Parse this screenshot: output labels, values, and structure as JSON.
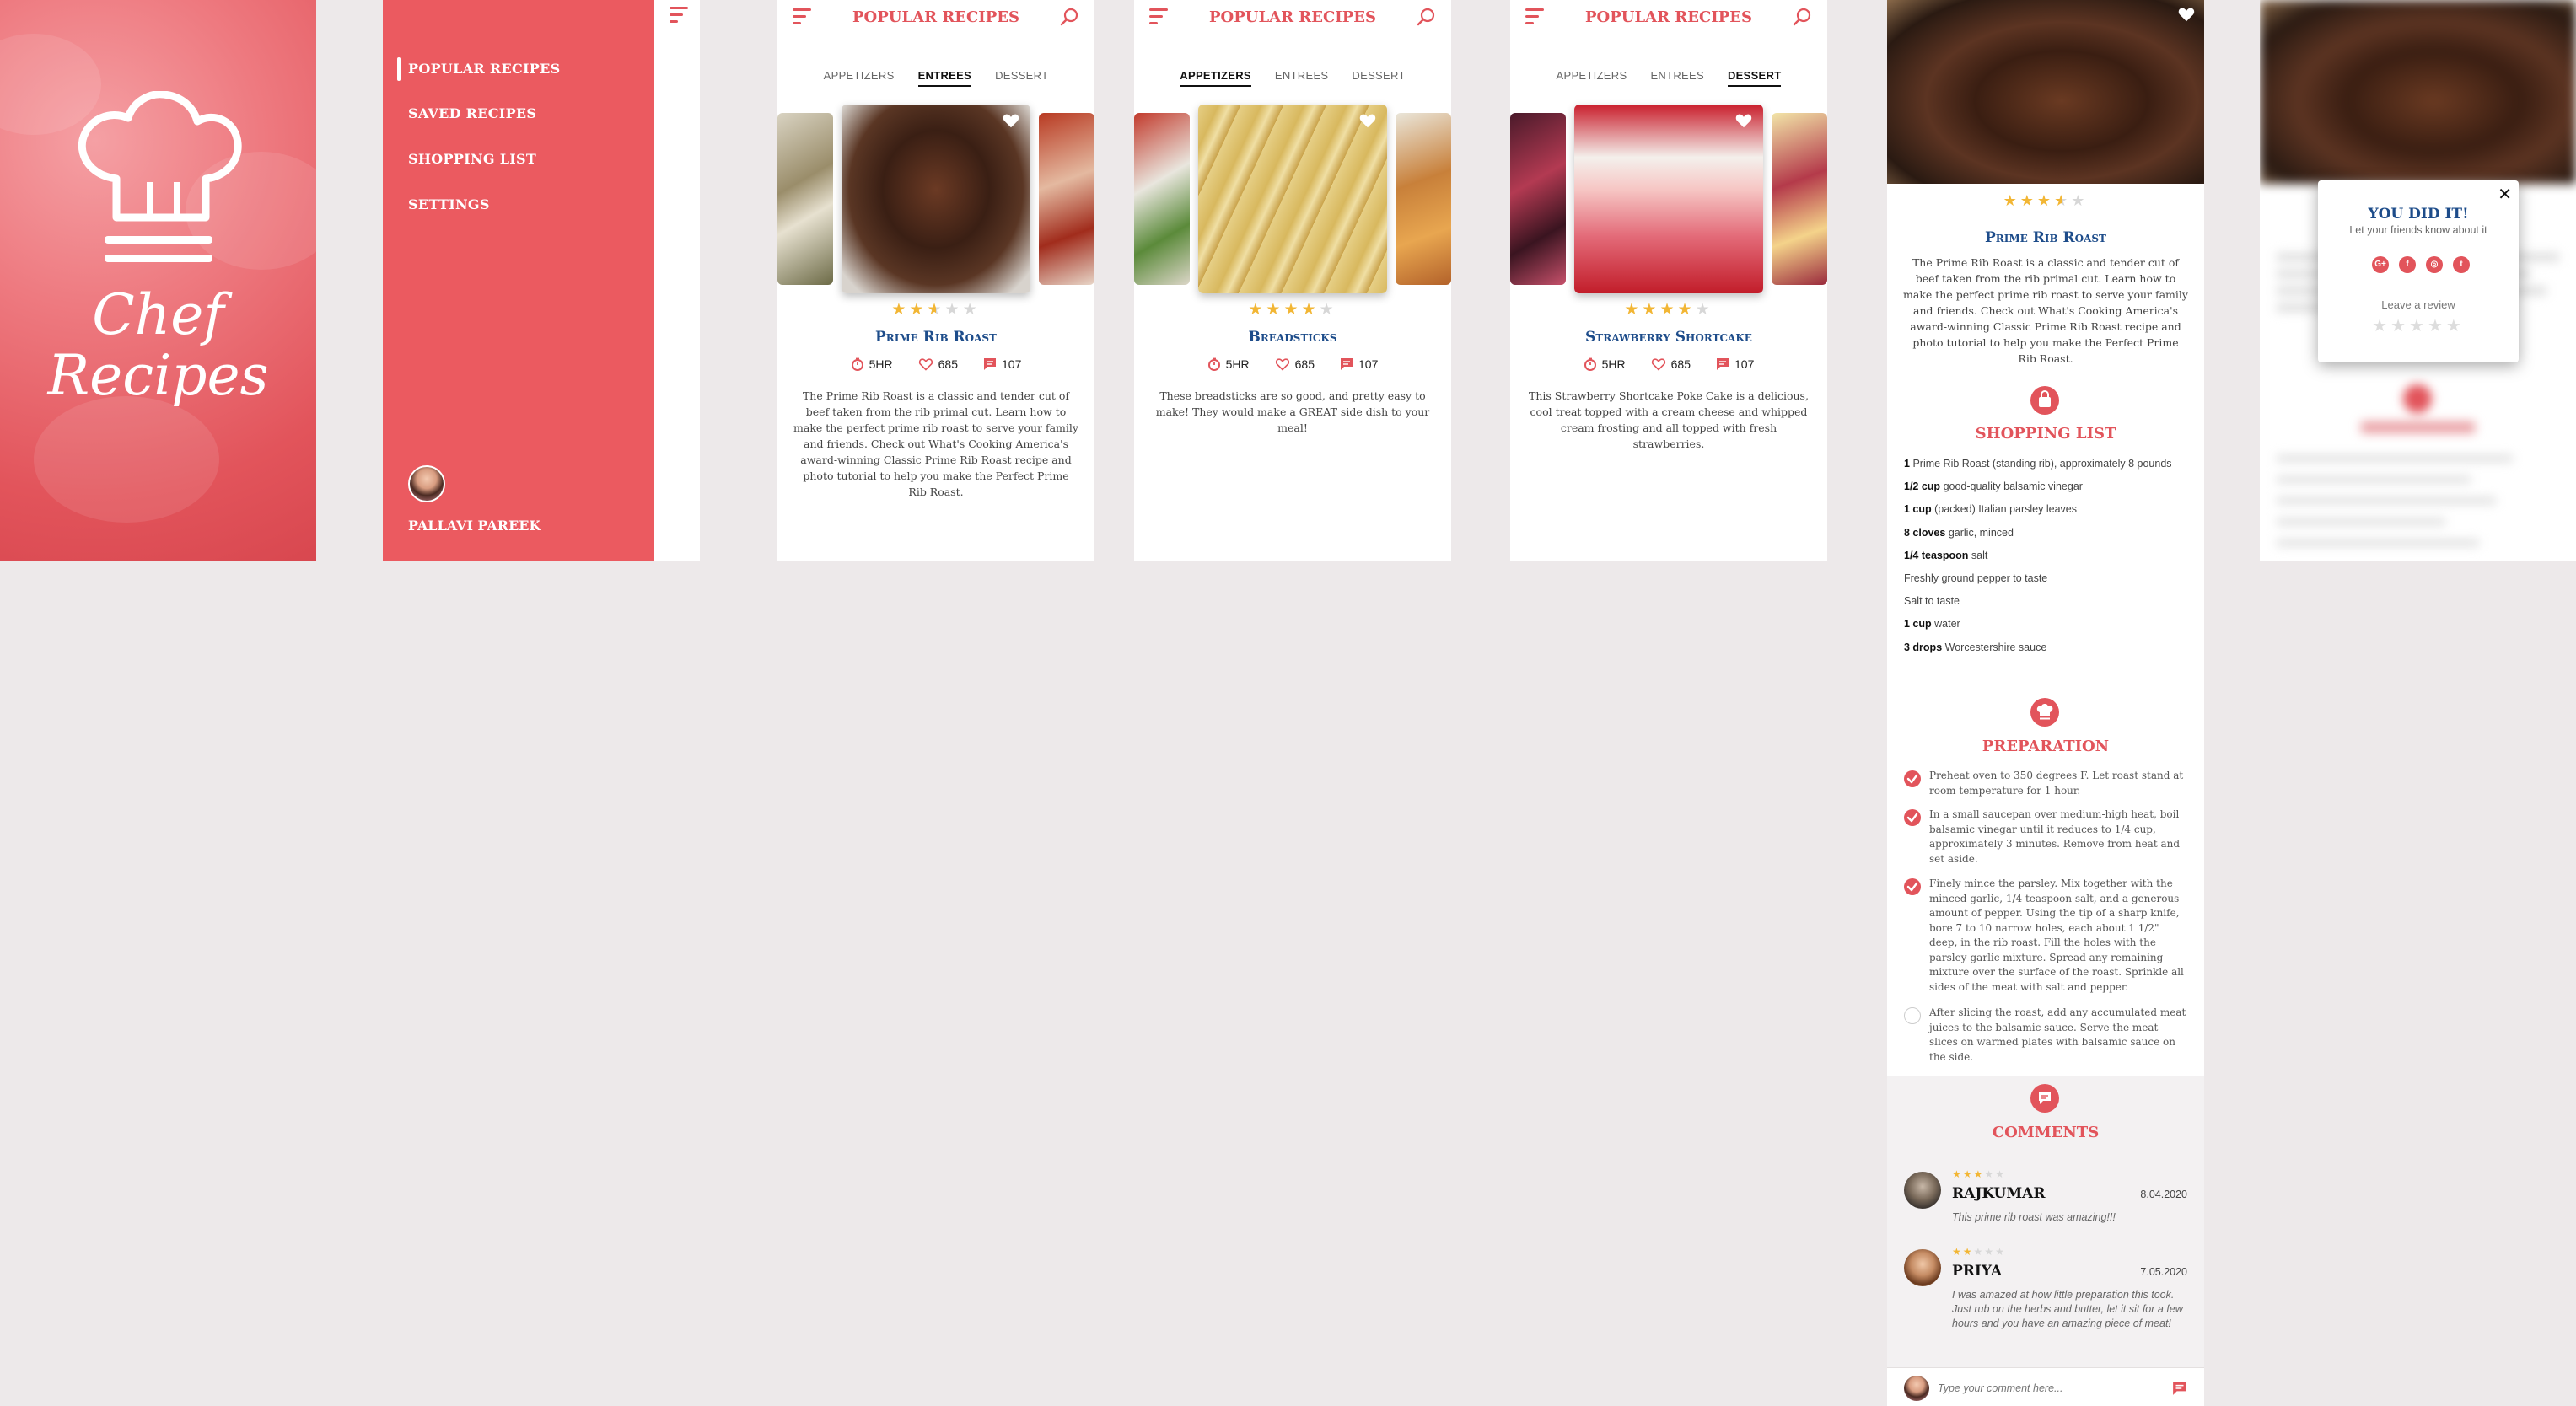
{
  "splash": {
    "title_line1": "Chef",
    "title_line2": "Recipes"
  },
  "drawer": {
    "items": [
      {
        "label": "POPULAR RECIPES"
      },
      {
        "label": "SAVED RECIPES"
      },
      {
        "label": "SHOPPING LIST"
      },
      {
        "label": "SETTINGS"
      }
    ],
    "user_name": "PALLAVI PAREEK"
  },
  "app": {
    "title": "POPULAR RECIPES"
  },
  "tabs": [
    "APPETIZERS",
    "ENTREES",
    "DESSERT"
  ],
  "screens": [
    {
      "active_tab": "ENTREES",
      "recipe": "Prime Rib Roast",
      "rating": 2.5,
      "time": "5HR",
      "likes": "685",
      "comments": "107",
      "description": "The Prime Rib Roast is a classic and tender cut of beef taken from the rib primal cut.  Learn how to make the perfect prime rib roast to serve your family and friends.  Check out What's Cooking America's award-winning Classic Prime Rib Roast recipe and photo tutorial to help you make the Perfect Prime Rib Roast."
    },
    {
      "active_tab": "APPETIZERS",
      "recipe": "Breadsticks",
      "rating": 4,
      "time": "5HR",
      "likes": "685",
      "comments": "107",
      "description": "These breadsticks are so good, and pretty easy to make! They would make a GREAT side dish to your meal!"
    },
    {
      "active_tab": "DESSERT",
      "recipe": "Strawberry Shortcake",
      "rating": 4,
      "time": "5HR",
      "likes": "685",
      "comments": "107",
      "description": "This Strawberry Shortcake Poke Cake is a delicious, cool treat topped with a cream cheese and whipped cream frosting and all topped with fresh strawberries."
    }
  ],
  "detail": {
    "recipe": "Prime Rib Roast",
    "rating": 3.5,
    "description": "The Prime Rib Roast is a classic and tender cut of beef taken from the rib primal cut.  Learn how to make the perfect prime rib roast to serve your family and friends.  Check out What's Cooking America's award-winning Classic Prime Rib Roast recipe and photo tutorial to help you make the Perfect Prime Rib Roast.",
    "shopping_title": "SHOPPING LIST",
    "ingredients": [
      {
        "qty": "1",
        "text": "Prime Rib Roast (standing rib), approximately 8 pounds"
      },
      {
        "qty": "1/2 cup",
        "text": "good-quality balsamic vinegar"
      },
      {
        "qty": "1 cup",
        "text": "(packed) Italian parsley leaves"
      },
      {
        "qty": "8 cloves",
        "text": "garlic, minced"
      },
      {
        "qty": "1/4 teaspoon",
        "text": "salt"
      },
      {
        "qty": "",
        "text": "Freshly ground pepper to taste"
      },
      {
        "qty": "",
        "text": "Salt to taste"
      },
      {
        "qty": "1 cup",
        "text": "water"
      },
      {
        "qty": "3 drops",
        "text": "Worcestershire sauce"
      }
    ],
    "preparation_title": "PREPARATION",
    "steps": [
      {
        "text": "Preheat oven to 350 degrees F.  Let roast stand at room temperature for 1 hour.",
        "done": true
      },
      {
        "text": "In a small saucepan over medium-high heat, boil balsamic vinegar until it reduces to 1/4 cup, approximately 3 minutes.  Remove from heat and set aside.",
        "done": true
      },
      {
        "text": "Finely mince the parsley.  Mix together with the minced garlic, 1/4 teaspoon salt, and a generous amount of pepper.  Using the tip of a sharp knife, bore 7 to 10 narrow holes, each about 1 1/2\" deep, in the rib roast.  Fill the holes with the parsley-garlic mixture.  Spread any remaining mixture over the surface of the roast.  Sprinkle all sides of the meat with salt and pepper.",
        "done": true
      },
      {
        "text": "After slicing the roast, add any accumulated meat juices to the balsamic sauce.  Serve the meat slices on warmed plates with balsamic sauce on the side.",
        "done": false
      }
    ],
    "comments_title": "COMMENTS",
    "comments": [
      {
        "name": "RAJKUMAR",
        "date": "8.04.2020",
        "rating": 3,
        "text": "This prime rib roast was amazing!!!"
      },
      {
        "name": "PRIYA",
        "date": "7.05.2020",
        "rating": 2,
        "text": "I was amazed at how little preparation this took. Just rub on the herbs and butter, let it sit for a few hours and you have an amazing piece of meat!"
      }
    ],
    "comment_placeholder": "Type your comment here..."
  },
  "popup": {
    "title": "YOU DID IT!",
    "subtitle": "Let your friends know about it",
    "social": [
      "G+",
      "f",
      "◎",
      "t"
    ],
    "review_label": "Leave a review"
  },
  "colors": {
    "accent": "#e2545b",
    "title_blue": "#1d4c8a",
    "star": "#f2b634"
  }
}
